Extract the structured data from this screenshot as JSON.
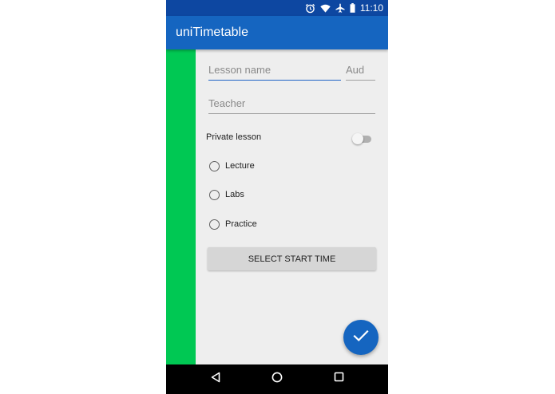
{
  "status_bar": {
    "time": "11:10",
    "icons": [
      "alarm-icon",
      "wifi-icon",
      "airplane-icon",
      "battery-icon"
    ]
  },
  "app_bar": {
    "title": "uniTimetable"
  },
  "form": {
    "lesson_name_placeholder": "Lesson name",
    "lesson_name_value": "",
    "aud_placeholder": "Aud",
    "aud_value": "",
    "teacher_placeholder": "Teacher",
    "teacher_value": "",
    "private_lesson_label": "Private lesson",
    "private_lesson_on": false,
    "lesson_types": [
      {
        "label": "Lecture",
        "selected": false
      },
      {
        "label": "Labs",
        "selected": false
      },
      {
        "label": "Practice",
        "selected": false
      }
    ],
    "select_start_time_label": "SELECT START TIME"
  },
  "fab": {
    "icon": "check-icon"
  },
  "nav_bar": {
    "icons": [
      "back-icon",
      "home-icon",
      "recents-icon"
    ]
  },
  "colors": {
    "status_bar": "#0d47a1",
    "app_bar": "#1565c0",
    "lesson_color": "#00c853",
    "accent": "#1e63c6",
    "background": "#eeeeee"
  }
}
